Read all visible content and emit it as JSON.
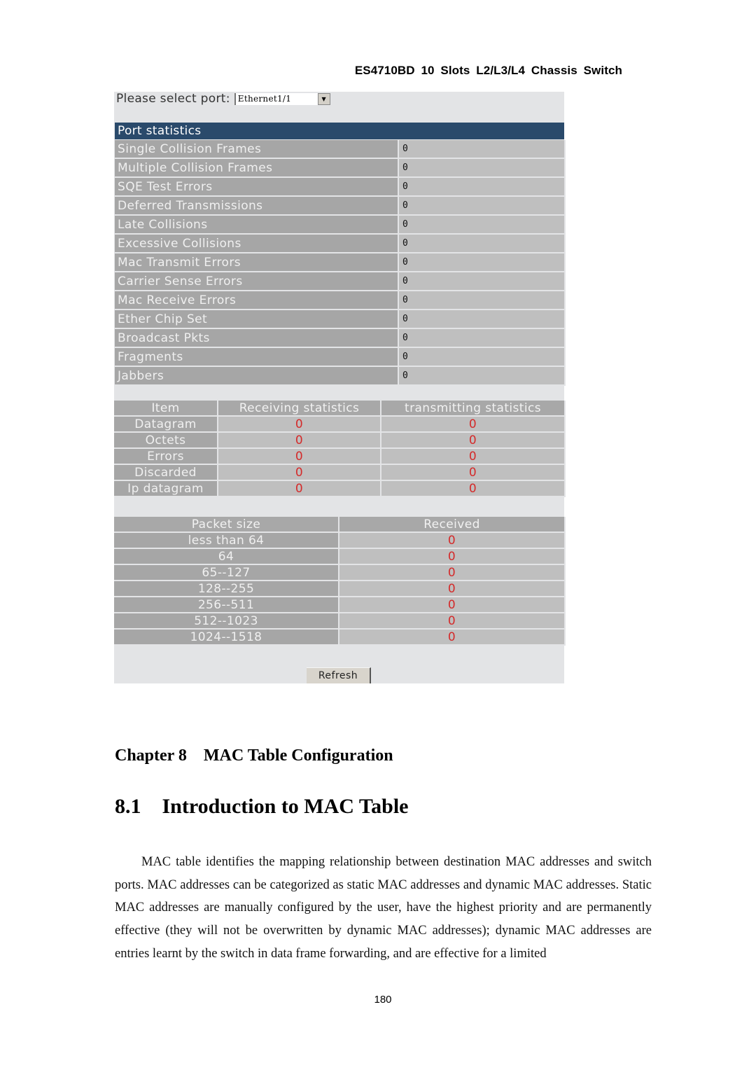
{
  "header": {
    "title": "ES4710BD  10  Slots  L2/L3/L4  Chassis  Switch"
  },
  "port_selector": {
    "label": "Please select port:",
    "selected": "Ethernet1/1",
    "arrow_icon": "▼"
  },
  "port_statistics": {
    "title": "Port statistics",
    "rows": [
      {
        "label": "Single Collision Frames",
        "value": "0"
      },
      {
        "label": "Multiple Collision Frames",
        "value": "0"
      },
      {
        "label": "SQE Test Errors",
        "value": "0"
      },
      {
        "label": "Deferred Transmissions",
        "value": "0"
      },
      {
        "label": "Late Collisions",
        "value": "0"
      },
      {
        "label": "Excessive Collisions",
        "value": "0"
      },
      {
        "label": "Mac Transmit Errors",
        "value": "0"
      },
      {
        "label": "Carrier Sense Errors",
        "value": "0"
      },
      {
        "label": "Mac Receive Errors",
        "value": "0"
      },
      {
        "label": "Ether Chip Set",
        "value": "0"
      },
      {
        "label": "Broadcast Pkts",
        "value": "0"
      },
      {
        "label": "Fragments",
        "value": "0"
      },
      {
        "label": "Jabbers",
        "value": "0"
      }
    ]
  },
  "ip_statistics": {
    "headers": [
      "Item",
      "Receiving statistics",
      "transmitting statistics"
    ],
    "rows": [
      {
        "item": "Datagram",
        "receiving": "0",
        "transmitting": "0"
      },
      {
        "item": "Octets",
        "receiving": "0",
        "transmitting": "0"
      },
      {
        "item": "Errors",
        "receiving": "0",
        "transmitting": "0"
      },
      {
        "item": "Discarded",
        "receiving": "0",
        "transmitting": "0"
      },
      {
        "item": "Ip datagram",
        "receiving": "0",
        "transmitting": "0"
      }
    ]
  },
  "packet_size_statistics": {
    "headers": [
      "Packet size",
      "Received"
    ],
    "rows": [
      {
        "size": "less than 64",
        "received": "0"
      },
      {
        "size": "64",
        "received": "0"
      },
      {
        "size": "65--127",
        "received": "0"
      },
      {
        "size": "128--255",
        "received": "0"
      },
      {
        "size": "256--511",
        "received": "0"
      },
      {
        "size": "512--1023",
        "received": "0"
      },
      {
        "size": "1024--1518",
        "received": "0"
      }
    ]
  },
  "refresh_button": {
    "label": "Refresh"
  },
  "chapter": {
    "title": "Chapter 8    MAC Table Configuration"
  },
  "section": {
    "title": "8.1    Introduction to MAC Table"
  },
  "body": {
    "paragraph": "MAC table identifies the mapping relationship between destination MAC addresses and switch ports. MAC addresses can be categorized as static MAC addresses and dynamic MAC addresses. Static MAC addresses are manually configured by the user, have the highest priority and are permanently effective (they will not be overwritten by dynamic MAC addresses); dynamic MAC addresses are entries learnt by the switch in data frame forwarding, and are effective for a limited"
  },
  "footer": {
    "page_number": "180"
  },
  "colors": {
    "section_bar": "#2a4a6b",
    "frame_background": "#e3e4e6",
    "label_cell": "#a6a6a6",
    "value_cell": "#bfbfbf",
    "highlight_value": "#d42a2a"
  }
}
